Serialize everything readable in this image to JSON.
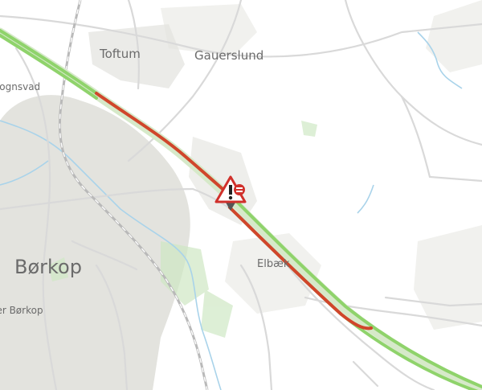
{
  "map": {
    "places": {
      "toftum": "Toftum",
      "gauerslund": "Gauerslund",
      "vognsvad": "Vognsvad",
      "borkop": "Børkop",
      "elbaek": "Elbæk",
      "oer_borkop": "Øer Børkop"
    },
    "traffic": {
      "free_flow_color": "#8fd36b",
      "congestion_color": "#d0462b"
    },
    "incident_marker": {
      "icon": "roadwork-warning-icon"
    }
  }
}
